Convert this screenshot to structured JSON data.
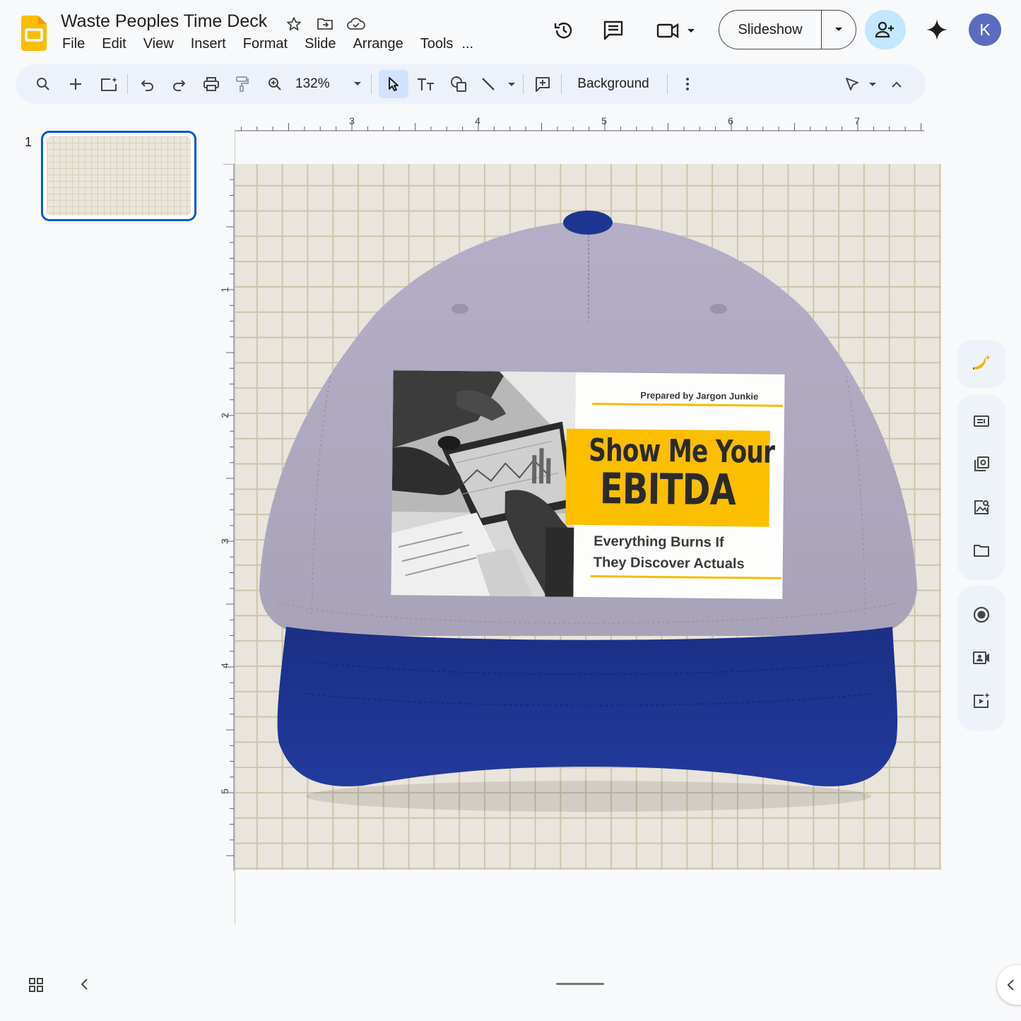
{
  "app": {
    "title": "Waste Peoples Time Deck",
    "menu": [
      "File",
      "Edit",
      "View",
      "Insert",
      "Format",
      "Slide",
      "Arrange",
      "Tools"
    ],
    "menu_more": "...",
    "slideshow_label": "Slideshow",
    "avatar_letter": "K",
    "accent_color": "#0b57d0"
  },
  "toolbar": {
    "zoom": "132%",
    "background_label": "Background"
  },
  "filmstrip": {
    "slides": [
      {
        "number": "1"
      }
    ]
  },
  "rulers": {
    "top": [
      "3",
      "4",
      "5",
      "6",
      "7"
    ],
    "left": [
      "1",
      "2",
      "3",
      "4",
      "5"
    ]
  },
  "slide": {
    "prepared_by": "Prepared by Jargon Junkie",
    "headline_line1": "Show Me Your",
    "headline_line2": "EBITDA",
    "subline1": "Everything Burns If",
    "subline2": "They Discover Actuals",
    "hat_crown_color": "#ada7bf",
    "hat_brim_color": "#1f3590",
    "highlight_color": "#fbbf00"
  }
}
